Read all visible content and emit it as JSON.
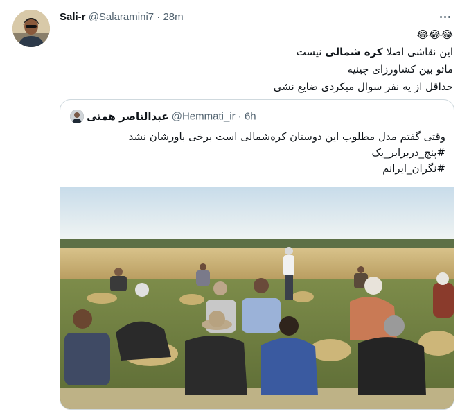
{
  "tweet": {
    "display_name": "Sali-r",
    "handle": "@Salaramini7",
    "separator": "·",
    "time": "28m",
    "emoji": "😂😂😂",
    "line1_pre": "این نقاشی اصلا",
    "line1_bold": "کره شمالی",
    "line1_post": "نیست",
    "line2": "مائو بین کشاورزای چینیه",
    "line3": "حداقل از یه نفر سوال میکردی ضایع نشی"
  },
  "quoted_tweet": {
    "display_name": "عبدالناصر همتی",
    "handle": "@Hemmati_ir",
    "separator": "·",
    "time": "6h",
    "line1": "وقتی گفتم مدل مطلوب این دوستان کره‌شمالی است برخی باورشان نشد",
    "line2": "#پنج_دربرابر_یک",
    "line3": "#نگران_ایرانم"
  },
  "colors": {
    "text": "#0f1419",
    "secondary": "#536471",
    "border": "#cfd9de"
  }
}
